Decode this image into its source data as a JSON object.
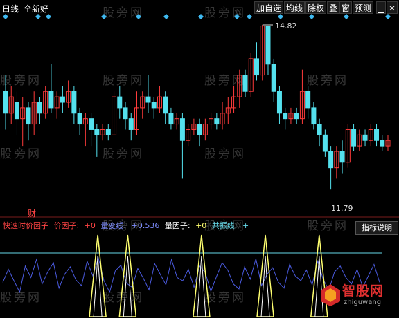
{
  "toolbar": {
    "period": "日线",
    "scope": "全新好",
    "add_watch": "加自选",
    "ma_lines": "均线",
    "rights": "除权",
    "overlay": "叠",
    "window": "窗",
    "forecast": "预测"
  },
  "price_labels": {
    "high": "14.82",
    "low": "11.79"
  },
  "watermark": "股旁网",
  "indicator": {
    "name": "快速时价因子",
    "price_factor_label": "价因子:",
    "price_factor_value": "+0",
    "volume_line_label": "量变线:",
    "volume_line_value": "+0.536",
    "volume_factor_label": "量因子:",
    "volume_factor_value": "+0",
    "resonance_label": "共振线:",
    "resonance_value": "+",
    "help_button": "指标说明",
    "marker": "财"
  },
  "logo": {
    "name": "智股网",
    "url": "zhiguwang"
  },
  "colors": {
    "up": "#ff3b3b",
    "down": "#54e1ee",
    "diamond": "#3fb9f0",
    "volume_line": "#4b5be0",
    "signal": "#ffff70",
    "reference": "#66d8e8"
  },
  "chart_data": {
    "type": "candlestick",
    "price_range": [
      11.79,
      14.82
    ],
    "candles": [
      {
        "o": 13.6,
        "c": 13.2,
        "h": 13.9,
        "l": 12.9
      },
      {
        "o": 13.2,
        "c": 13.5,
        "h": 13.7,
        "l": 13.0
      },
      {
        "o": 13.4,
        "c": 13.1,
        "h": 13.6,
        "l": 12.8
      },
      {
        "o": 13.1,
        "c": 13.3,
        "h": 13.5,
        "l": 12.6
      },
      {
        "o": 13.3,
        "c": 13.0,
        "h": 13.4,
        "l": 12.7
      },
      {
        "o": 13.0,
        "c": 13.4,
        "h": 13.6,
        "l": 12.8
      },
      {
        "o": 13.4,
        "c": 13.2,
        "h": 13.5,
        "l": 13.0
      },
      {
        "o": 13.2,
        "c": 13.6,
        "h": 13.7,
        "l": 13.1
      },
      {
        "o": 13.6,
        "c": 13.3,
        "h": 14.1,
        "l": 13.2
      },
      {
        "o": 13.3,
        "c": 13.5,
        "h": 13.6,
        "l": 13.1
      },
      {
        "o": 13.5,
        "c": 13.4,
        "h": 13.7,
        "l": 13.2
      },
      {
        "o": 13.4,
        "c": 13.6,
        "h": 13.8,
        "l": 13.3
      },
      {
        "o": 13.6,
        "c": 13.2,
        "h": 13.7,
        "l": 13.0
      },
      {
        "o": 13.2,
        "c": 13.0,
        "h": 13.3,
        "l": 12.8
      },
      {
        "o": 13.0,
        "c": 13.1,
        "h": 13.2,
        "l": 12.6
      },
      {
        "o": 13.1,
        "c": 12.9,
        "h": 13.2,
        "l": 12.6
      },
      {
        "o": 12.9,
        "c": 12.8,
        "h": 13.0,
        "l": 12.4
      },
      {
        "o": 12.8,
        "c": 12.9,
        "h": 13.0,
        "l": 12.7
      },
      {
        "o": 12.9,
        "c": 12.8,
        "h": 13.0,
        "l": 12.7
      },
      {
        "o": 12.8,
        "c": 13.5,
        "h": 13.6,
        "l": 12.8
      },
      {
        "o": 13.5,
        "c": 13.3,
        "h": 13.7,
        "l": 13.1
      },
      {
        "o": 13.3,
        "c": 13.1,
        "h": 13.4,
        "l": 12.9
      },
      {
        "o": 13.1,
        "c": 12.9,
        "h": 13.2,
        "l": 12.7
      },
      {
        "o": 12.9,
        "c": 13.3,
        "h": 13.6,
        "l": 12.8
      },
      {
        "o": 13.3,
        "c": 13.5,
        "h": 13.6,
        "l": 13.1
      },
      {
        "o": 13.5,
        "c": 13.4,
        "h": 13.9,
        "l": 13.2
      },
      {
        "o": 13.4,
        "c": 13.3,
        "h": 13.5,
        "l": 13.1
      },
      {
        "o": 13.3,
        "c": 13.5,
        "h": 13.7,
        "l": 13.2
      },
      {
        "o": 13.5,
        "c": 13.2,
        "h": 13.6,
        "l": 13.0
      },
      {
        "o": 13.2,
        "c": 13.0,
        "h": 13.3,
        "l": 12.9
      },
      {
        "o": 13.0,
        "c": 13.1,
        "h": 13.2,
        "l": 12.9
      },
      {
        "o": 13.1,
        "c": 12.7,
        "h": 13.2,
        "l": 12.0
      },
      {
        "o": 12.7,
        "c": 12.9,
        "h": 13.0,
        "l": 12.6
      },
      {
        "o": 12.9,
        "c": 13.0,
        "h": 13.1,
        "l": 12.8
      },
      {
        "o": 13.0,
        "c": 12.8,
        "h": 13.1,
        "l": 12.6
      },
      {
        "o": 12.8,
        "c": 13.0,
        "h": 13.1,
        "l": 12.7
      },
      {
        "o": 13.0,
        "c": 13.1,
        "h": 13.2,
        "l": 12.9
      },
      {
        "o": 13.1,
        "c": 13.0,
        "h": 13.2,
        "l": 12.9
      },
      {
        "o": 13.0,
        "c": 13.2,
        "h": 13.4,
        "l": 12.9
      },
      {
        "o": 13.2,
        "c": 13.3,
        "h": 13.5,
        "l": 13.0
      },
      {
        "o": 13.3,
        "c": 13.5,
        "h": 13.7,
        "l": 13.2
      },
      {
        "o": 13.5,
        "c": 13.9,
        "h": 14.0,
        "l": 13.3
      },
      {
        "o": 13.9,
        "c": 13.6,
        "h": 14.0,
        "l": 13.5
      },
      {
        "o": 13.6,
        "c": 14.2,
        "h": 14.3,
        "l": 13.5
      },
      {
        "o": 14.2,
        "c": 13.9,
        "h": 14.5,
        "l": 13.8
      },
      {
        "o": 13.9,
        "c": 14.8,
        "h": 14.82,
        "l": 13.8
      },
      {
        "o": 14.8,
        "c": 14.1,
        "h": 14.8,
        "l": 13.9
      },
      {
        "o": 14.1,
        "c": 13.6,
        "h": 14.2,
        "l": 13.4
      },
      {
        "o": 13.6,
        "c": 13.2,
        "h": 13.7,
        "l": 13.0
      },
      {
        "o": 13.2,
        "c": 13.1,
        "h": 13.3,
        "l": 12.9
      },
      {
        "o": 13.1,
        "c": 13.2,
        "h": 13.3,
        "l": 13.0
      },
      {
        "o": 13.2,
        "c": 13.1,
        "h": 13.3,
        "l": 13.0
      },
      {
        "o": 13.1,
        "c": 13.6,
        "h": 14.0,
        "l": 13.0
      },
      {
        "o": 13.6,
        "c": 13.3,
        "h": 13.7,
        "l": 13.1
      },
      {
        "o": 13.3,
        "c": 13.0,
        "h": 13.4,
        "l": 12.9
      },
      {
        "o": 13.0,
        "c": 12.8,
        "h": 13.1,
        "l": 12.6
      },
      {
        "o": 12.8,
        "c": 12.5,
        "h": 12.9,
        "l": 12.4
      },
      {
        "o": 12.5,
        "c": 12.2,
        "h": 12.6,
        "l": 11.8
      },
      {
        "o": 12.2,
        "c": 12.5,
        "h": 12.6,
        "l": 12.0
      },
      {
        "o": 12.5,
        "c": 12.3,
        "h": 12.7,
        "l": 12.1
      },
      {
        "o": 12.3,
        "c": 12.9,
        "h": 13.0,
        "l": 12.2
      },
      {
        "o": 12.9,
        "c": 12.6,
        "h": 13.0,
        "l": 12.5
      },
      {
        "o": 12.6,
        "c": 12.8,
        "h": 12.9,
        "l": 12.5
      },
      {
        "o": 12.8,
        "c": 12.7,
        "h": 12.9,
        "l": 12.6
      },
      {
        "o": 12.7,
        "c": 12.9,
        "h": 13.0,
        "l": 12.6
      },
      {
        "o": 12.9,
        "c": 12.7,
        "h": 13.0,
        "l": 12.6
      },
      {
        "o": 12.7,
        "c": 12.6,
        "h": 12.8,
        "l": 12.5
      },
      {
        "o": 12.6,
        "c": 12.7,
        "h": 12.8,
        "l": 12.5
      }
    ],
    "volume_line": [
      42,
      58,
      44,
      30,
      62,
      48,
      70,
      40,
      55,
      66,
      35,
      52,
      61,
      45,
      38,
      68,
      50,
      72,
      44,
      30,
      56,
      63,
      41,
      36,
      59,
      47,
      33,
      65,
      52,
      39,
      70,
      48,
      44,
      58,
      36,
      62,
      54,
      31,
      49,
      66,
      57,
      40,
      34,
      61,
      46,
      71,
      38,
      52,
      60,
      42,
      35,
      64,
      50,
      44,
      57,
      39,
      68,
      45,
      33,
      55,
      62,
      48,
      40,
      58,
      36,
      50,
      64,
      42
    ],
    "signal_spikes": [
      0.245,
      0.32,
      0.505,
      0.665,
      0.8
    ],
    "reference_level": 0.78
  }
}
